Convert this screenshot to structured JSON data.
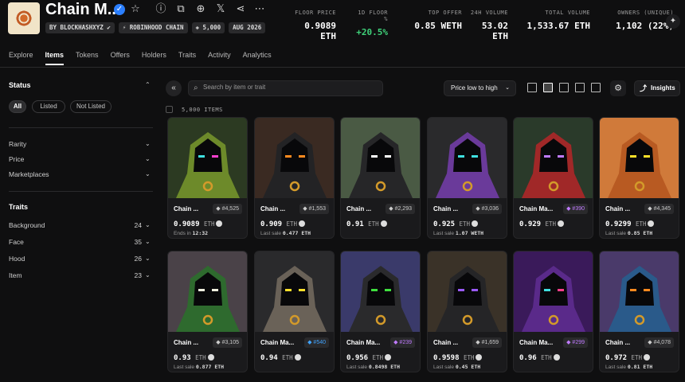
{
  "collection": {
    "title": "Chain M...",
    "chips": [
      "BY BLOCKHASHXYZ ✔",
      "⚡ ROBINHOOD CHAIN",
      "◈ 5,000",
      "AUG 2026"
    ]
  },
  "stats": [
    {
      "label": "FLOOR PRICE",
      "value": "0.9089 ETH",
      "positive": false
    },
    {
      "label": "1D FLOOR %",
      "value": "+20.5%",
      "positive": true
    },
    {
      "label": "TOP OFFER",
      "value": "0.85 WETH",
      "positive": false
    },
    {
      "label": "24H VOLUME",
      "value": "53.02 ETH",
      "positive": false
    },
    {
      "label": "TOTAL VOLUME",
      "value": "1,533.67 ETH",
      "positive": false
    },
    {
      "label": "OWNERS (UNIQUE)",
      "value": "1,102 (22%)",
      "positive": false
    }
  ],
  "tabs": [
    "Explore",
    "Items",
    "Tokens",
    "Offers",
    "Holders",
    "Traits",
    "Activity",
    "Analytics"
  ],
  "sidebar": {
    "status_title": "Status",
    "status_pills": [
      "All",
      "Listed",
      "Not Listed"
    ],
    "filters": [
      "Rarity",
      "Price",
      "Marketplaces"
    ],
    "traits_title": "Traits",
    "traits": [
      {
        "name": "Background",
        "count": "24"
      },
      {
        "name": "Face",
        "count": "35"
      },
      {
        "name": "Hood",
        "count": "26"
      },
      {
        "name": "Item",
        "count": "23"
      }
    ]
  },
  "toolbar": {
    "search_placeholder": "Search by item or trait",
    "sort_label": "Price low to high",
    "insights_label": "Insights",
    "items_count": "5,000 ITEMS"
  },
  "colors": {
    "accent_green": "#3fd27a",
    "epic_purple": "#c07bff",
    "rare_blue": "#3fa3ff"
  },
  "cards": [
    {
      "name": "Chain ...",
      "rank": "#4,525",
      "rank_tier": "",
      "price": "0.9089",
      "currency": "ETH",
      "sub_label": "Ends in",
      "sub_value": "12:32",
      "hood": "#6d8a2a",
      "bg": "#2c3a22",
      "eyes": "#3fe0e0",
      "eye2": "#ff3fd0",
      "mouth": ""
    },
    {
      "name": "Chain ...",
      "rank": "#1,553",
      "rank_tier": "",
      "price": "0.909",
      "currency": "ETH",
      "sub_label": "Last sale",
      "sub_value": "0.477 ETH",
      "hood": "#232325",
      "bg": "#3a2a22",
      "eyes": "#ff8a1f",
      "eye2": "#ff8a1f",
      "mouth": ""
    },
    {
      "name": "Chain ...",
      "rank": "#2,293",
      "rank_tier": "",
      "price": "0.91",
      "currency": "ETH",
      "sub_label": "",
      "sub_value": "",
      "hood": "#262628",
      "bg": "#4a5a44",
      "eyes": "#ffffff",
      "eye2": "#ffffff",
      "mouth": ""
    },
    {
      "name": "Chain ...",
      "rank": "#3,036",
      "rank_tier": "",
      "price": "0.925",
      "currency": "ETH",
      "sub_label": "Last sale",
      "sub_value": "1.07 WETH",
      "hood": "#6a3a9a",
      "bg": "#2a2a2c",
      "eyes": "#3fe0e0",
      "eye2": "#3fe0e0",
      "mouth": ""
    },
    {
      "name": "Chain Ma...",
      "rank": "#390",
      "rank_tier": "epic",
      "price": "0.929",
      "currency": "ETH",
      "sub_label": "",
      "sub_value": "",
      "hood": "#a02828",
      "bg": "#2a3a2a",
      "eyes": "#c07bff",
      "eye2": "#c07bff",
      "mouth": ""
    },
    {
      "name": "Chain ...",
      "rank": "#4,345",
      "rank_tier": "",
      "price": "0.9299",
      "currency": "ETH",
      "sub_label": "Last sale",
      "sub_value": "0.85 ETH",
      "hood": "#b85a22",
      "bg": "#d07a3a",
      "eyes": "#ffe02a",
      "eye2": "#ffe02a",
      "mouth": ""
    },
    {
      "name": "Chain ...",
      "rank": "#3,105",
      "rank_tier": "",
      "price": "0.93",
      "currency": "ETH",
      "sub_label": "Last sale",
      "sub_value": "0.877 ETH",
      "hood": "#2e6a2e",
      "bg": "#4a4248",
      "eyes": "#f0f0e0",
      "eye2": "#f0f0e0",
      "mouth": ""
    },
    {
      "name": "Chain Ma...",
      "rank": "#540",
      "rank_tier": "rare",
      "price": "0.94",
      "currency": "ETH",
      "sub_label": "",
      "sub_value": "",
      "hood": "#6a6258",
      "bg": "#2a2a2c",
      "eyes": "#ffe02a",
      "eye2": "#ffe02a",
      "mouth": ""
    },
    {
      "name": "Chain Ma...",
      "rank": "#239",
      "rank_tier": "epic",
      "price": "0.956",
      "currency": "ETH",
      "sub_label": "Last sale",
      "sub_value": "0.8498 ETH",
      "hood": "#2a2a2c",
      "bg": "#3a3a6a",
      "eyes": "#3fe03f",
      "eye2": "#3fe03f",
      "mouth": ""
    },
    {
      "name": "Chain ...",
      "rank": "#1,659",
      "rank_tier": "",
      "price": "0.9598",
      "currency": "ETH",
      "sub_label": "Last sale",
      "sub_value": "0.45 ETH",
      "hood": "#252527",
      "bg": "#3a3228",
      "eyes": "#9a5aff",
      "eye2": "#9a5aff",
      "mouth": ""
    },
    {
      "name": "Chain Ma...",
      "rank": "#299",
      "rank_tier": "epic",
      "price": "0.96",
      "currency": "ETH",
      "sub_label": "",
      "sub_value": "",
      "hood": "#5a2a8a",
      "bg": "#3a1a5a",
      "eyes": "#3fe0e0",
      "eye2": "#ff3f8a",
      "mouth": ""
    },
    {
      "name": "Chain ...",
      "rank": "#4,078",
      "rank_tier": "",
      "price": "0.972",
      "currency": "ETH",
      "sub_label": "Last sale",
      "sub_value": "0.81 ETH",
      "hood": "#2a5a8a",
      "bg": "#4a3a6a",
      "eyes": "#ff8a1f",
      "eye2": "#ff8a1f",
      "mouth": ""
    }
  ]
}
